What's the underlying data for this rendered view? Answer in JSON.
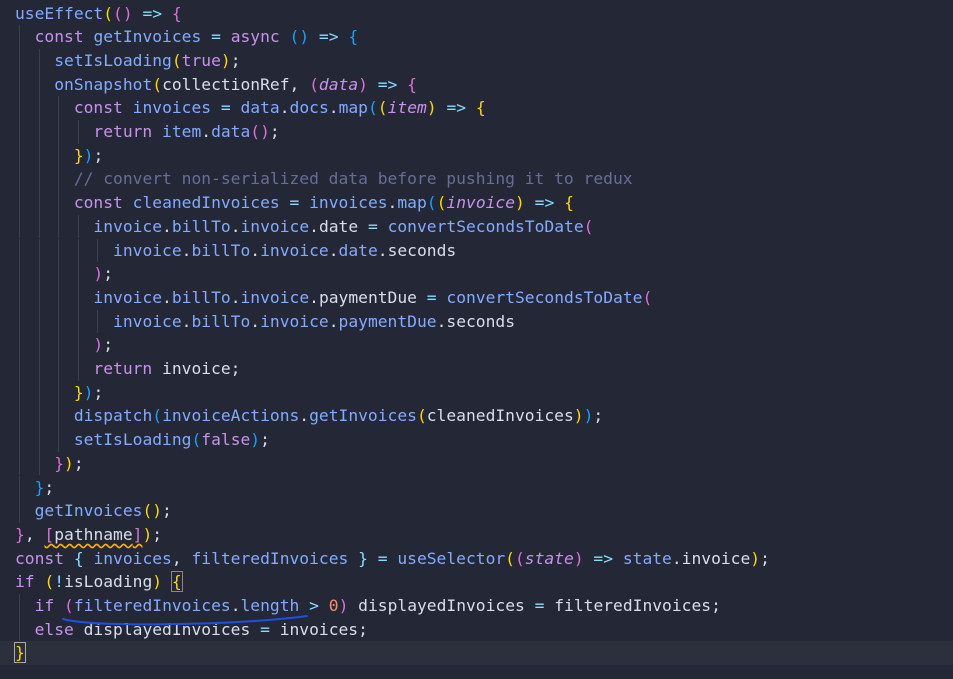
{
  "editor": {
    "lines": [
      [
        [
          "useEffect",
          "fn"
        ],
        [
          "(",
          "b1"
        ],
        [
          "()",
          "b2"
        ],
        [
          " => ",
          "op"
        ],
        [
          "{",
          "b2"
        ]
      ],
      [
        [
          "  ",
          "ws"
        ],
        [
          "const ",
          "kw"
        ],
        [
          "getInvoices",
          "fn"
        ],
        [
          " = ",
          "op"
        ],
        [
          "async ",
          "kw"
        ],
        [
          "()",
          "b3"
        ],
        [
          " => ",
          "op"
        ],
        [
          "{",
          "b3"
        ]
      ],
      [
        [
          "    ",
          "ws"
        ],
        [
          "setIsLoading",
          "fn"
        ],
        [
          "(",
          "b1"
        ],
        [
          "true",
          "bool"
        ],
        [
          ")",
          "b1"
        ],
        [
          ";",
          "var"
        ]
      ],
      [
        [
          "    ",
          "ws"
        ],
        [
          "onSnapshot",
          "fn"
        ],
        [
          "(",
          "b1"
        ],
        [
          "collectionRef, ",
          "var"
        ],
        [
          "(",
          "b2"
        ],
        [
          "data",
          "param"
        ],
        [
          ")",
          "b2"
        ],
        [
          " => ",
          "op"
        ],
        [
          "{",
          "b2"
        ]
      ],
      [
        [
          "      ",
          "ws"
        ],
        [
          "const ",
          "kw"
        ],
        [
          "invoices",
          "prop"
        ],
        [
          " = ",
          "op"
        ],
        [
          "data",
          "prop"
        ],
        [
          ".",
          "var"
        ],
        [
          "docs",
          "prop"
        ],
        [
          ".",
          "var"
        ],
        [
          "map",
          "fn"
        ],
        [
          "(",
          "b3"
        ],
        [
          "(",
          "b1"
        ],
        [
          "item",
          "param"
        ],
        [
          ")",
          "b1"
        ],
        [
          " => ",
          "op"
        ],
        [
          "{",
          "b1"
        ]
      ],
      [
        [
          "        ",
          "ws"
        ],
        [
          "return ",
          "kw"
        ],
        [
          "item",
          "prop"
        ],
        [
          ".",
          "var"
        ],
        [
          "data",
          "fn"
        ],
        [
          "()",
          "b2"
        ],
        [
          ";",
          "var"
        ]
      ],
      [
        [
          "      ",
          "ws"
        ],
        [
          "}",
          "b1"
        ],
        [
          ")",
          "b3"
        ],
        [
          ";",
          "var"
        ]
      ],
      [
        [
          "      ",
          "ws"
        ],
        [
          "// convert non-serialized data before pushing it to redux",
          "comment"
        ]
      ],
      [
        [
          "      ",
          "ws"
        ],
        [
          "const ",
          "kw"
        ],
        [
          "cleanedInvoices",
          "prop"
        ],
        [
          " = ",
          "op"
        ],
        [
          "invoices",
          "prop"
        ],
        [
          ".",
          "var"
        ],
        [
          "map",
          "fn"
        ],
        [
          "(",
          "b3"
        ],
        [
          "(",
          "b1"
        ],
        [
          "invoice",
          "param"
        ],
        [
          ")",
          "b1"
        ],
        [
          " => ",
          "op"
        ],
        [
          "{",
          "b1"
        ]
      ],
      [
        [
          "        ",
          "ws"
        ],
        [
          "invoice",
          "prop"
        ],
        [
          ".",
          "var"
        ],
        [
          "billTo",
          "prop"
        ],
        [
          ".",
          "var"
        ],
        [
          "invoice",
          "prop"
        ],
        [
          ".",
          "var"
        ],
        [
          "date",
          "var"
        ],
        [
          " = ",
          "op"
        ],
        [
          "convertSecondsToDate",
          "fn"
        ],
        [
          "(",
          "b2"
        ]
      ],
      [
        [
          "          ",
          "ws"
        ],
        [
          "invoice",
          "prop"
        ],
        [
          ".",
          "var"
        ],
        [
          "billTo",
          "prop"
        ],
        [
          ".",
          "var"
        ],
        [
          "invoice",
          "prop"
        ],
        [
          ".",
          "var"
        ],
        [
          "date",
          "prop"
        ],
        [
          ".",
          "var"
        ],
        [
          "seconds",
          "var"
        ]
      ],
      [
        [
          "        ",
          "ws"
        ],
        [
          ")",
          "b2"
        ],
        [
          ";",
          "var"
        ]
      ],
      [
        [
          "        ",
          "ws"
        ],
        [
          "invoice",
          "prop"
        ],
        [
          ".",
          "var"
        ],
        [
          "billTo",
          "prop"
        ],
        [
          ".",
          "var"
        ],
        [
          "invoice",
          "prop"
        ],
        [
          ".",
          "var"
        ],
        [
          "paymentDue",
          "var"
        ],
        [
          " = ",
          "op"
        ],
        [
          "convertSecondsToDate",
          "fn"
        ],
        [
          "(",
          "b2"
        ]
      ],
      [
        [
          "          ",
          "ws"
        ],
        [
          "invoice",
          "prop"
        ],
        [
          ".",
          "var"
        ],
        [
          "billTo",
          "prop"
        ],
        [
          ".",
          "var"
        ],
        [
          "invoice",
          "prop"
        ],
        [
          ".",
          "var"
        ],
        [
          "paymentDue",
          "prop"
        ],
        [
          ".",
          "var"
        ],
        [
          "seconds",
          "var"
        ]
      ],
      [
        [
          "        ",
          "ws"
        ],
        [
          ")",
          "b2"
        ],
        [
          ";",
          "var"
        ]
      ],
      [
        [
          "        ",
          "ws"
        ],
        [
          "return ",
          "kw"
        ],
        [
          "invoice",
          "var"
        ],
        [
          ";",
          "var"
        ]
      ],
      [
        [
          "      ",
          "ws"
        ],
        [
          "}",
          "b1"
        ],
        [
          ")",
          "b3"
        ],
        [
          ";",
          "var"
        ]
      ],
      [
        [
          "      ",
          "ws"
        ],
        [
          "dispatch",
          "fn"
        ],
        [
          "(",
          "b3"
        ],
        [
          "invoiceActions",
          "prop"
        ],
        [
          ".",
          "var"
        ],
        [
          "getInvoices",
          "fn"
        ],
        [
          "(",
          "b1"
        ],
        [
          "cleanedInvoices",
          "var"
        ],
        [
          ")",
          "b1"
        ],
        [
          ")",
          "b3"
        ],
        [
          ";",
          "var"
        ]
      ],
      [
        [
          "      ",
          "ws"
        ],
        [
          "setIsLoading",
          "fn"
        ],
        [
          "(",
          "b3"
        ],
        [
          "false",
          "bool"
        ],
        [
          ")",
          "b3"
        ],
        [
          ";",
          "var"
        ]
      ],
      [
        [
          "    ",
          "ws"
        ],
        [
          "}",
          "b2"
        ],
        [
          ")",
          "b1"
        ],
        [
          ";",
          "var"
        ]
      ],
      [
        [
          "  ",
          "ws"
        ],
        [
          "}",
          "b3"
        ],
        [
          ";",
          "var"
        ]
      ],
      [
        [
          "  ",
          "ws"
        ],
        [
          "getInvoices",
          "fn"
        ],
        [
          "()",
          "b1"
        ],
        [
          ";",
          "var"
        ]
      ],
      [
        [
          "}",
          "b2"
        ],
        [
          ", ",
          "var"
        ],
        [
          "[",
          "b2"
        ],
        [
          "pathname",
          "var"
        ],
        [
          "]",
          "b2"
        ],
        [
          ")",
          "b1"
        ],
        [
          ";",
          "var"
        ]
      ],
      [
        [
          "const ",
          "kw"
        ],
        [
          "{ ",
          "op"
        ],
        [
          "invoices",
          "prop"
        ],
        [
          ", ",
          "var"
        ],
        [
          "filteredInvoices",
          "prop"
        ],
        [
          " } ",
          "op"
        ],
        [
          "= ",
          "op"
        ],
        [
          "useSelector",
          "fn"
        ],
        [
          "(",
          "b1"
        ],
        [
          "(",
          "b2"
        ],
        [
          "state",
          "param"
        ],
        [
          ")",
          "b2"
        ],
        [
          " => ",
          "op"
        ],
        [
          "state",
          "prop"
        ],
        [
          ".",
          "var"
        ],
        [
          "invoice",
          "var"
        ],
        [
          ")",
          "b1"
        ],
        [
          ";",
          "var"
        ]
      ],
      [
        [
          "if ",
          "kw"
        ],
        [
          "(",
          "b1"
        ],
        [
          "!",
          "op"
        ],
        [
          "isLoading",
          "var"
        ],
        [
          ")",
          "b1"
        ],
        [
          " ",
          "ws"
        ],
        [
          "{",
          "b1"
        ]
      ],
      [
        [
          "  ",
          "ws"
        ],
        [
          "if ",
          "kw"
        ],
        [
          "(",
          "b2"
        ],
        [
          "filteredInvoices",
          "prop"
        ],
        [
          ".",
          "var"
        ],
        [
          "length",
          "prop"
        ],
        [
          " > ",
          "op"
        ],
        [
          "0",
          "num"
        ],
        [
          ")",
          "b2"
        ],
        [
          " displayedInvoices ",
          "var"
        ],
        [
          "= ",
          "op"
        ],
        [
          "filteredInvoices",
          "var"
        ],
        [
          ";",
          "var"
        ]
      ],
      [
        [
          "  ",
          "ws"
        ],
        [
          "else ",
          "kw"
        ],
        [
          "displayedInvoices ",
          "var"
        ],
        [
          "= ",
          "op"
        ],
        [
          "invoices",
          "var"
        ],
        [
          ";",
          "var"
        ]
      ],
      [
        [
          "}",
          "b1"
        ]
      ]
    ]
  },
  "colors": {
    "background": "#242836",
    "current_line": "#2c303d",
    "ink_underline": "#1f4fe0"
  }
}
